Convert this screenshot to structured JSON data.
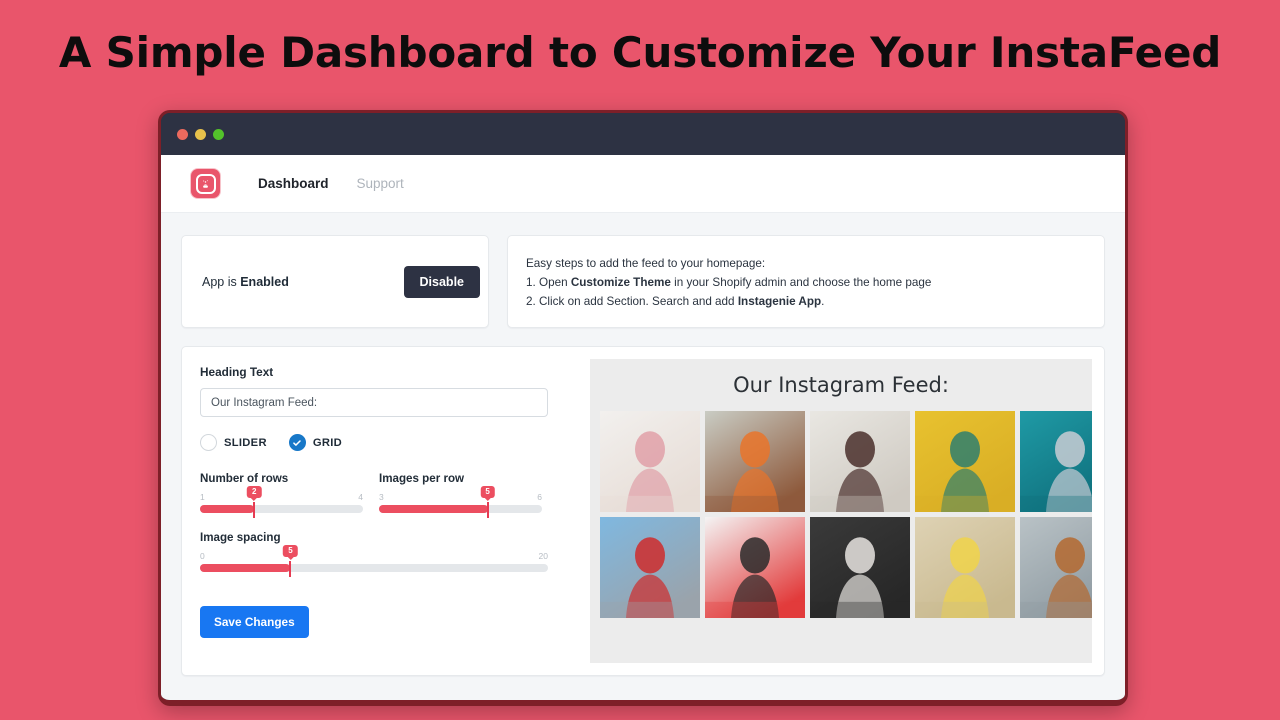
{
  "headline": "A Simple Dashboard to Customize Your InstaFeed",
  "window": {
    "traffic_lights": [
      "close",
      "minimize",
      "maximize"
    ]
  },
  "nav": {
    "logo_icon": "instagenie-logo-icon",
    "links": [
      {
        "label": "Dashboard",
        "active": true
      },
      {
        "label": "Support",
        "active": false
      }
    ]
  },
  "status_card": {
    "prefix": "App is ",
    "state": "Enabled",
    "button_label": "Disable"
  },
  "steps_card": {
    "intro": "Easy steps to add the feed to your homepage:",
    "step1_pre": "1. Open ",
    "step1_bold": "Customize Theme",
    "step1_post": " in your Shopify admin and choose the home page",
    "step2_pre": "2. Click on add Section. Search and add ",
    "step2_bold": "Instagenie App",
    "step2_post": "."
  },
  "settings": {
    "heading_label": "Heading Text",
    "heading_value": "Our Instagram Feed:",
    "heading_placeholder": "Our Instagram Feed:",
    "layout_options": [
      {
        "label": "SLIDER",
        "selected": false
      },
      {
        "label": "GRID",
        "selected": true
      }
    ],
    "sliders": [
      {
        "title": "Number of rows",
        "min": "1",
        "max": "4",
        "value": "2",
        "percent": 33.3
      },
      {
        "title": "Images per row",
        "min": "3",
        "max": "6",
        "value": "5",
        "percent": 66.6
      },
      {
        "title": "Image spacing",
        "min": "0",
        "max": "20",
        "value": "5",
        "percent": 26.0
      }
    ],
    "save_label": "Save Changes"
  },
  "preview": {
    "heading": "Our Instagram Feed:",
    "rows": 2,
    "per_row": 5,
    "tiles": [
      {
        "alt": "white-tshirt-flatlay",
        "c1": "#f2f0ee",
        "c2": "#e7ddd6",
        "accent": "#e0a0a8"
      },
      {
        "alt": "orange-dress-street",
        "c1": "#c9ccc4",
        "c2": "#8e5a3c",
        "accent": "#e9742a"
      },
      {
        "alt": "floral-top-white-wall",
        "c1": "#e9e7e2",
        "c2": "#cfcac2",
        "accent": "#4a2f2c"
      },
      {
        "alt": "yellow-wall-sunglasses",
        "c1": "#e8c22f",
        "c2": "#d9ae25",
        "accent": "#2e7f6e"
      },
      {
        "alt": "teal-door-grey-dress",
        "c1": "#1f9aa5",
        "c2": "#0f6f7c",
        "accent": "#c9ccd4"
      },
      {
        "alt": "street-style-red-bag",
        "c1": "#7fb8e0",
        "c2": "#9aa3ab",
        "accent": "#cf2b2b"
      },
      {
        "alt": "black-hat-red-backdrop",
        "c1": "#f4f4f4",
        "c2": "#e23b3b",
        "accent": "#2a2a2a"
      },
      {
        "alt": "dark-portrait-ruffle",
        "c1": "#3a3a3a",
        "c2": "#272727",
        "accent": "#e7e4e0"
      },
      {
        "alt": "yellow-skirt-rocks",
        "c1": "#ded2b4",
        "c2": "#c9b98f",
        "accent": "#f0d34a"
      },
      {
        "alt": "brown-top-lake",
        "c1": "#b9c2c6",
        "c2": "#8e9aa1",
        "accent": "#b4682f"
      }
    ]
  },
  "colors": {
    "page_background": "#e9556b",
    "titlebar": "#2d3243",
    "accent_red": "#ec4e60",
    "accent_blue": "#1877f2",
    "radio_blue": "#1878c8"
  }
}
